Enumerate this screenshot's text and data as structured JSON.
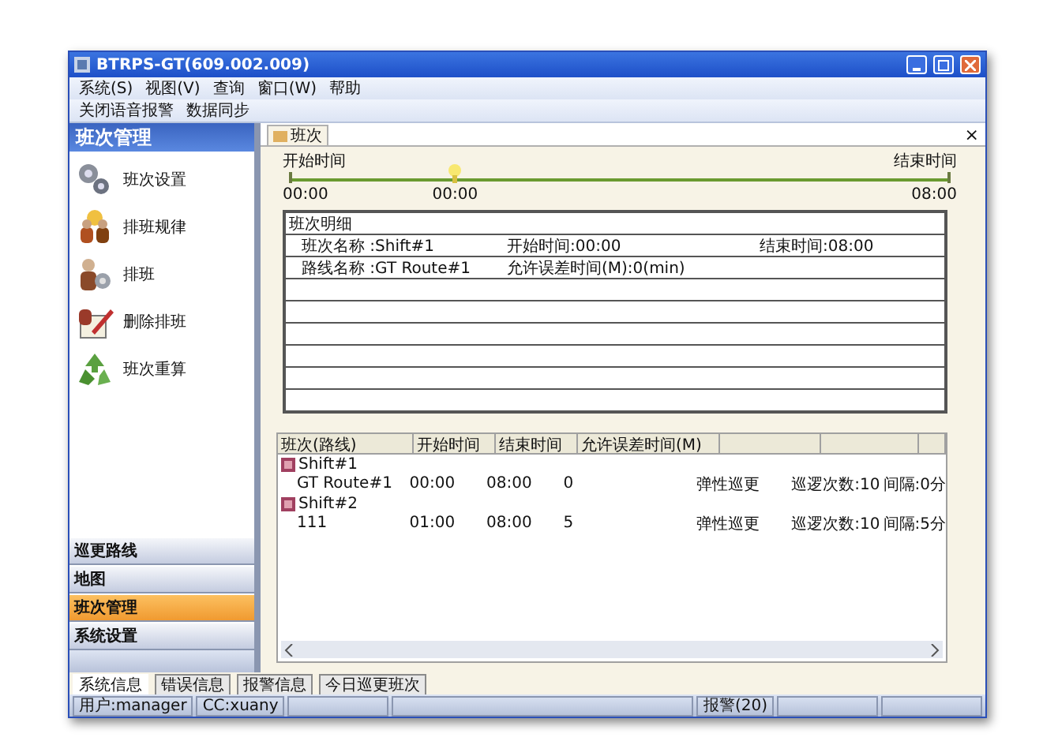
{
  "window": {
    "title": "BTRPS-GT(609.002.009)"
  },
  "menu": [
    "系统(S)",
    "视图(V)",
    "查询",
    "窗口(W)",
    "帮助"
  ],
  "toolbar": [
    "关闭语音报警",
    "数据同步"
  ],
  "sidebar": {
    "title": "班次管理",
    "items": [
      "班次设置",
      "排班规律",
      "排班",
      "删除排班",
      "班次重算"
    ]
  },
  "nav": [
    {
      "label": "巡更路线",
      "selected": false
    },
    {
      "label": "地图",
      "selected": false
    },
    {
      "label": "班次管理",
      "selected": true
    },
    {
      "label": "系统设置",
      "selected": false
    }
  ],
  "tabs": [
    {
      "label": "班次",
      "selected": true
    }
  ],
  "tab_close": "×",
  "timeline": {
    "start_label": "开始时间",
    "end_label": "结束时间",
    "start": "00:00",
    "marker": "00:00",
    "end": "08:00",
    "level": 0.25
  },
  "details": {
    "title": "班次明细",
    "rows": [
      [
        "班次名称 :Shift#1",
        "开始时间:00:00",
        "结束时间:08:00"
      ],
      [
        "路线名称 :GT Route#1",
        "允许误差时间(M):0(min)"
      ]
    ]
  },
  "list": {
    "columns": [
      "班次(路线)",
      "开始时间",
      "结束时间",
      "允许误差时间(M)"
    ],
    "groups": [
      {
        "name": "Shift#1",
        "rows": [
          [
            "GT Route#1",
            "00:00",
            "08:00",
            "0",
            "弹性巡更",
            "巡逻次数:10",
            "间隔:0分"
          ]
        ]
      },
      {
        "name": "Shift#2",
        "rows": [
          [
            "111",
            "01:00",
            "08:00",
            "5",
            "弹性巡更",
            "巡逻次数:10",
            "间隔:5分"
          ]
        ]
      }
    ]
  },
  "bottom_tabs": [
    {
      "label": "系统信息",
      "selected": true
    },
    {
      "label": "错误信息",
      "selected": false
    },
    {
      "label": "报警信息",
      "selected": false
    },
    {
      "label": "今日巡更班次",
      "selected": false
    }
  ],
  "status_bar": [
    "用户:manager",
    "CC:xuany",
    "报警(20)"
  ]
}
